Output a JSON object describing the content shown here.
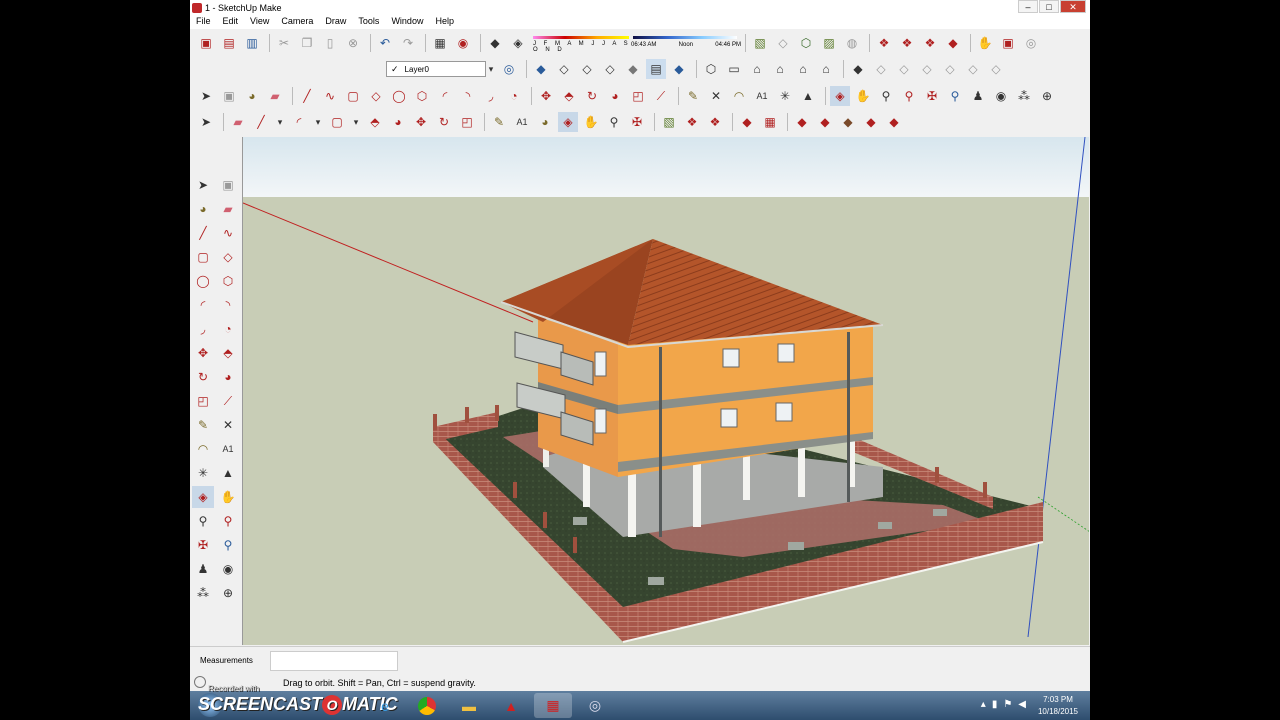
{
  "window": {
    "title": "1 - SketchUp Make",
    "app_icon": "sketchup-icon"
  },
  "window_controls": {
    "minimize": "–",
    "maximize": "□",
    "close": "✕"
  },
  "menu": [
    "File",
    "Edit",
    "View",
    "Camera",
    "Draw",
    "Tools",
    "Window",
    "Help"
  ],
  "shadows": {
    "months": "J F M A M J J A S O N D",
    "time_start": "06:43 AM",
    "time_mid": "Noon",
    "time_end": "04:46 PM"
  },
  "layers": {
    "current": "Layer0",
    "checked": "✓"
  },
  "measurements": {
    "label": "Measurements",
    "value": ""
  },
  "status_message": "Drag to orbit. Shift = Pan, Ctrl = suspend gravity.",
  "taskbar": {
    "watermark": "SCREENCAST",
    "watermark_o": "O",
    "watermark_end": "MATIC",
    "recorded_with": "Recorded with",
    "clock_time": "7:03 PM",
    "clock_date": "10/18/2015"
  },
  "colors": {
    "sky": "#e6eff4",
    "ground": "#c8cdb6",
    "roof": "#b4552a",
    "wall": "#f2a64a",
    "brick": "#a8574a",
    "grass": "#3a4a32",
    "accent_red": "#b02020"
  },
  "icons": [
    "select-icon",
    "component-icon",
    "paint-bucket-icon",
    "eraser-icon",
    "line-icon",
    "freehand-icon",
    "rectangle-icon",
    "rotated-rectangle-icon",
    "circle-icon",
    "polygon-icon",
    "arc-icon",
    "two-point-arc-icon",
    "three-point-arc-icon",
    "pie-icon",
    "move-icon",
    "push-pull-icon",
    "rotate-icon",
    "follow-me-icon",
    "scale-icon",
    "offset-icon",
    "tape-measure-icon",
    "dimension-icon",
    "protractor-icon",
    "text-icon",
    "axes-icon",
    "3d-text-icon",
    "orbit-icon",
    "pan-icon",
    "zoom-icon",
    "zoom-window-icon",
    "zoom-extents-icon",
    "previous-view-icon",
    "position-camera-icon",
    "look-around-icon",
    "walk-icon",
    "section-plane-icon"
  ]
}
